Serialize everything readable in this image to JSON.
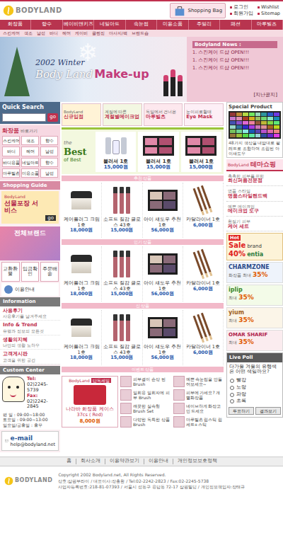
{
  "header": {
    "logo": "BODYLAND",
    "cart": "Shopping Bag",
    "links": [
      "로그인",
      "Wishlist",
      "회원가입",
      "Sitemap"
    ]
  },
  "nav": [
    "화장품",
    "향수",
    "베이비앤키즈",
    "네일아트",
    "속눈썹",
    "미용소품",
    "주얼리",
    "패션",
    "마루빌츠"
  ],
  "subnav": [
    "스킨케어",
    "색조",
    "남성",
    "바디",
    "헤어",
    "케이비",
    "클렌징",
    "마사지/팩",
    "브랜드숍"
  ],
  "banner": {
    "season": "2002 Winter",
    "brand": "Body Land",
    "title": "Make-up",
    "news_title": "Bodyland News :",
    "news": [
      "1. 스킨케어 드샵 OPEN!!!",
      "1. 스킨케어 드샵 OPEN!!!",
      "1. 스킨케어 드샵 OPEN!!!"
    ],
    "more": "[지난공지]"
  },
  "quick_search": {
    "title": "Quick Search",
    "button": "go"
  },
  "shortcut": {
    "title": "화장품",
    "subtitle": "바로가기",
    "items": [
      "스킨케어",
      "색조",
      "향수",
      "바디",
      "헤어",
      "남성",
      "바디용품",
      "네일아트",
      "향수",
      "마루빌츠",
      "미용소품",
      "남성"
    ]
  },
  "shopping_guide": {
    "title": "Shopping Guide",
    "brand": "BodyLand",
    "promo": "선물포장 서비스",
    "badge": "go"
  },
  "brands_banner": "전체브랜드",
  "service_icons": [
    "교환환불",
    "입금확인",
    "주문배송"
  ],
  "guide_link": "이용안내",
  "information": {
    "title": "Information",
    "items": [
      {
        "label": "사용후기",
        "desc": "사용후기를 남겨주세요"
      },
      {
        "label": "Info & Trend",
        "desc": "유행과 정보의 모든것"
      },
      {
        "label": "생활의지혜",
        "desc": "나만의 생활 노하우"
      },
      {
        "label": "고객게시판",
        "desc": "고객을 위한 공간"
      }
    ]
  },
  "custom_center": {
    "title": "Custom Center",
    "tel_label": "Tel:",
    "tel": "02)2245-5739",
    "fax_label": "Fax:",
    "fax": "02)2242-2845",
    "hours": [
      "평  일 : 09:00~18:00",
      "토요일 : 09:00~13:00",
      "일요일/공휴일 : 휴무"
    ]
  },
  "email": {
    "title": "e-mail",
    "address": "help@bodyland.net"
  },
  "promos": [
    {
      "small": "BodyLand",
      "big": "신규입점"
    },
    {
      "small": "계절에 따른",
      "big": "계절별메이크업"
    },
    {
      "small": "독일에서 건너온",
      "big": "마루빌츠"
    },
    {
      "small": "눈이피로할때",
      "big": "Eye Mask"
    }
  ],
  "best": {
    "the": "the",
    "title": "Best",
    "of": "of Best",
    "items": [
      {
        "name": "블러셔 1호",
        "price": "15,000원",
        "kind": "set"
      },
      {
        "name": "블러셔 1호",
        "price": "15,000원",
        "kind": "palette"
      },
      {
        "name": "블러셔 1호",
        "price": "15,000원",
        "kind": "palette"
      }
    ]
  },
  "product_rows": [
    {
      "header": "추천 상품",
      "items": [
        {
          "name": "케어플러그 크림 1호",
          "price": "18,000원",
          "kind": "cream"
        },
        {
          "name": "소프트 질감 글로스 43호",
          "price": "15,000원",
          "kind": "gloss"
        },
        {
          "name": "아이 섀도우 추천 1호",
          "price": "56,000원",
          "kind": "shadow"
        },
        {
          "name": "카달라이너 1호",
          "price": "6,000원",
          "kind": "liner"
        }
      ]
    },
    {
      "header": "인기 상품",
      "items": [
        {
          "name": "케어플러그 크림 1호",
          "price": "18,000원",
          "kind": "cream"
        },
        {
          "name": "소프트 질감 글로스 43호",
          "price": "15,000원",
          "kind": "gloss"
        },
        {
          "name": "아이 섀도우 추천 1호",
          "price": "56,000원",
          "kind": "shadow"
        },
        {
          "name": "카달라이너 1호",
          "price": "6,000원",
          "kind": "liner"
        }
      ]
    },
    {
      "header": "신 상품",
      "items": [
        {
          "name": "케어플러그 크림 1호",
          "price": "18,000원",
          "kind": "cream"
        },
        {
          "name": "소프트 질감 글로스 43호",
          "price": "15,000원",
          "kind": "gloss"
        },
        {
          "name": "아이 섀도우 추천 1호",
          "price": "56,000원",
          "kind": "shadow"
        },
        {
          "name": "카달라이너 1호",
          "price": "6,000원",
          "kind": "liner"
        }
      ]
    }
  ],
  "bottom": {
    "header": "이벤트 상품",
    "feature": {
      "brand": "BodyLand",
      "tag": "단독세일",
      "name": "나라바 화장품 케이스 37cs ( Red)",
      "price": "8,000원"
    },
    "items": [
      "피부결이 손상 된 Brush",
      "예쁜 속눈썹을 만들어보세요~",
      "일회용 일회자에 피부 Brush",
      "피부에 가세요? 개별화장품",
      "깨끗한 실속형 Brush Set",
      "네이브하게 화장고민 드세요",
      "다양한 독특한 상품 Brush",
      "마루빌츠 립스틱 립세트+스틱"
    ]
  },
  "special": {
    "title": "Special Product",
    "desc": "48가지 색상을 내맘대로 팔레트로 조합하여 조립된 아이섀도우"
  },
  "theme": {
    "brand": "BodyLand",
    "title": "테마쇼핑",
    "items": [
      {
        "small": "촉촉한 피부를 위한",
        "big": "최신퍼퓸전문점"
      },
      {
        "small": "명품 스타일",
        "big": "명품스타일핸드백"
      },
      {
        "small": "예쁜 메이크업",
        "big": "메이크업 도구"
      },
      {
        "small": "환절기 피부",
        "big": "케어 세트"
      }
    ]
  },
  "sale": {
    "badge": "Hot",
    "title": "Sale",
    "sub": "brand",
    "discount": "40%",
    "brand": "entia"
  },
  "brand_sales": [
    {
      "name": "CHARMZONE",
      "desc": "화장품 최대",
      "discount": "35%"
    },
    {
      "name": "iplip",
      "desc": "최대",
      "discount": "35%"
    },
    {
      "name": "yium",
      "desc": "최대",
      "discount": "35%"
    },
    {
      "name": "OMAR SHARIF",
      "desc": "최대",
      "discount": "35%"
    }
  ],
  "poll": {
    "title": "Live Poll",
    "question": "다가올 겨울의 유행색은 어떤 색일까요?",
    "options": [
      {
        "label": "빨강",
        "selected": false
      },
      {
        "label": "노랑",
        "selected": false
      },
      {
        "label": "파랑",
        "selected": false
      },
      {
        "label": "초록",
        "selected": false
      }
    ],
    "buttons": [
      "투표하기",
      "결과보기"
    ]
  },
  "footer": {
    "links": [
      "홈",
      "회사소개",
      "이용약관보기",
      "이용안내",
      "개인정보보호정책"
    ],
    "logo": "BODYLAND",
    "copyright": "Copyright 2002 Bodyland.net, All Rights Reserved.",
    "lines": [
      "상호:삼원부라이 / 대표이사:장흥환 / Tel:02-2242-2823 / Fax:02-2245-5738",
      "사업자등록번호:218-81-07393 / 서울시 성동구 용답동 72-17 삼원빌딩 / 개인정보책임자:장태규"
    ]
  }
}
